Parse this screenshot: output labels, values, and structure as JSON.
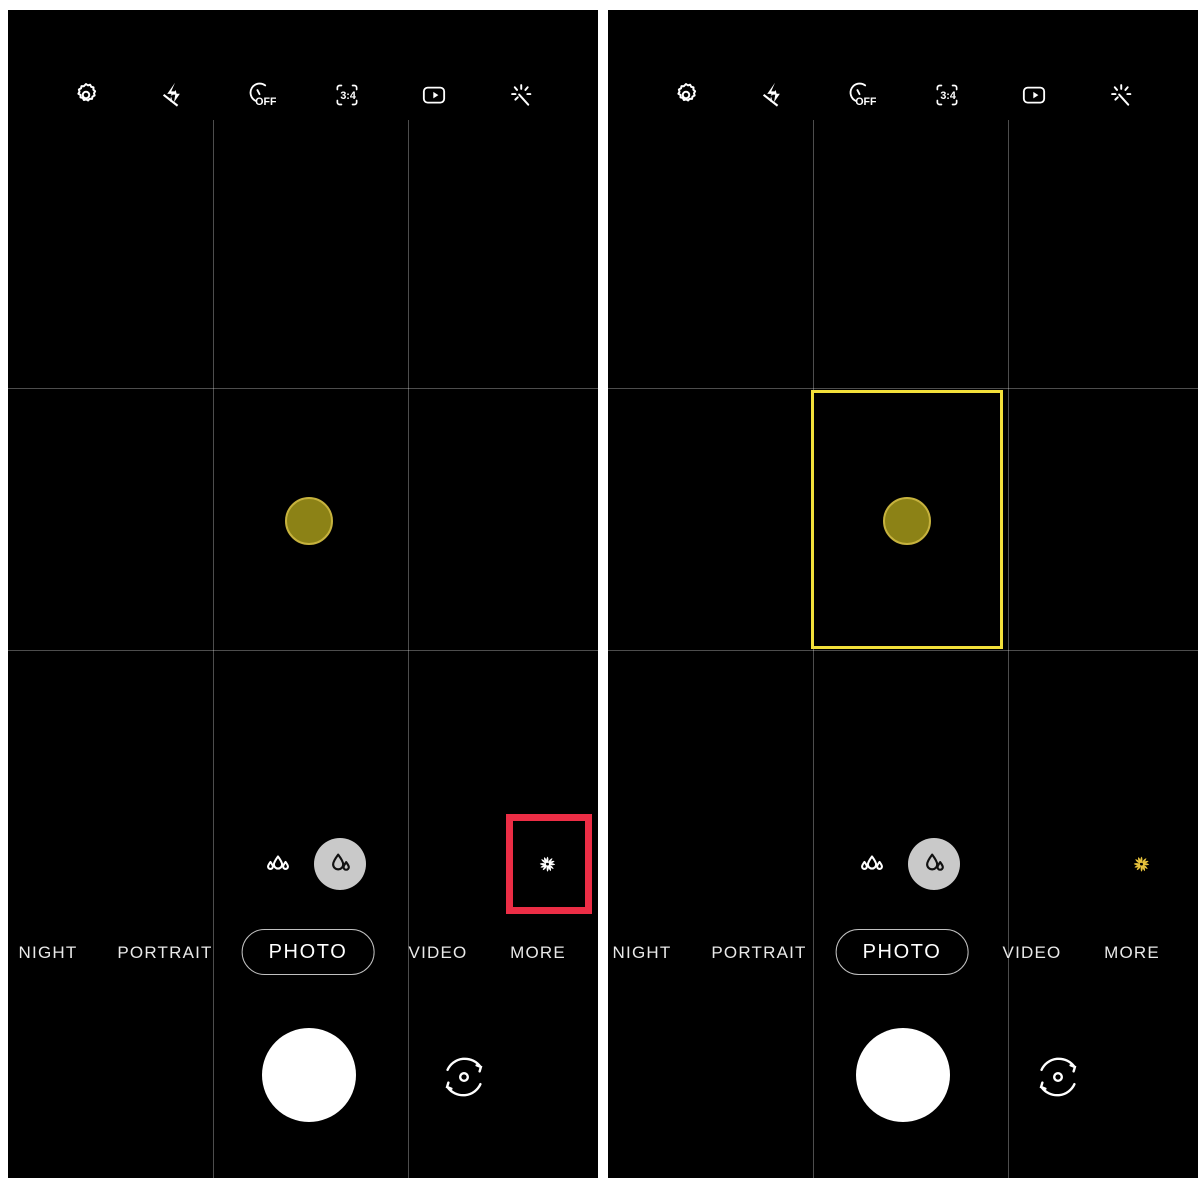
{
  "screenshot": {
    "type": "android-camera-app-comparison",
    "background_color": "#ffffff",
    "panel_background": "#000000"
  },
  "colors": {
    "accent_yellow": "#f3e03a",
    "annotation_red": "#ec2d45",
    "subject_fill": "#8c8216",
    "subject_ring": "#c6b23d",
    "active_filter_gold": "#e8c33c",
    "chip_gray": "#c9c9c9",
    "grid_line": "rgba(255,255,255,0.30)"
  },
  "panels": [
    {
      "id": "before",
      "label": "before-tapping-filter",
      "toolbar": {
        "items": [
          {
            "name": "settings-icon",
            "icon": "gear",
            "label": "Settings"
          },
          {
            "name": "flash-off-icon",
            "icon": "flash-off",
            "label": "Flash off"
          },
          {
            "name": "timer-icon",
            "icon": "timer-off",
            "label": "OFF",
            "value": "OFF"
          },
          {
            "name": "aspect-ratio-icon",
            "icon": "aspect-ratio",
            "label": "3:4",
            "value": "3:4"
          },
          {
            "name": "motion-photo-icon",
            "icon": "motion-photo",
            "label": "Motion photo"
          },
          {
            "name": "ai-enhance-icon",
            "icon": "sparkle",
            "label": "AI enhance"
          }
        ]
      },
      "viewfinder": {
        "grid_visible": true,
        "subject": {
          "name": "subject-circle",
          "shape": "circle",
          "color": "#8c8216"
        },
        "focus_box_visible": false
      },
      "effects": {
        "bokeh_off": {
          "name": "bokeh-off-icon",
          "label": "Bokeh off",
          "selected": false
        },
        "bokeh_on": {
          "name": "bokeh-on-icon",
          "label": "Bokeh on",
          "selected": true
        },
        "filter": {
          "name": "filter-icon",
          "label": "Filters",
          "active": false,
          "color": "#ffffff"
        }
      },
      "annotation": {
        "visible": true,
        "target": "filter-icon",
        "color": "#ec2d45"
      },
      "modes": [
        {
          "name": "mode-night",
          "label": "NIGHT",
          "selected": false
        },
        {
          "name": "mode-portrait",
          "label": "PORTRAIT",
          "selected": false
        },
        {
          "name": "mode-photo",
          "label": "PHOTO",
          "selected": true
        },
        {
          "name": "mode-video",
          "label": "VIDEO",
          "selected": false
        },
        {
          "name": "mode-more",
          "label": "MORE",
          "selected": false
        }
      ],
      "capture": {
        "shutter": {
          "name": "shutter-button",
          "label": "Shutter"
        },
        "flip": {
          "name": "flip-camera-icon",
          "label": "Switch camera"
        }
      }
    },
    {
      "id": "after",
      "label": "after-tapping-filter",
      "toolbar": {
        "items": [
          {
            "name": "settings-icon",
            "icon": "gear",
            "label": "Settings"
          },
          {
            "name": "flash-off-icon",
            "icon": "flash-off",
            "label": "Flash off"
          },
          {
            "name": "timer-icon",
            "icon": "timer-off",
            "label": "OFF",
            "value": "OFF"
          },
          {
            "name": "aspect-ratio-icon",
            "icon": "aspect-ratio",
            "label": "3:4",
            "value": "3:4"
          },
          {
            "name": "motion-photo-icon",
            "icon": "motion-photo",
            "label": "Motion photo"
          },
          {
            "name": "ai-enhance-icon",
            "icon": "sparkle",
            "label": "AI enhance"
          }
        ]
      },
      "viewfinder": {
        "grid_visible": true,
        "subject": {
          "name": "subject-circle",
          "shape": "circle",
          "color": "#8c8216"
        },
        "focus_box_visible": true,
        "focus_box_color": "#f3e03a"
      },
      "effects": {
        "bokeh_off": {
          "name": "bokeh-off-icon",
          "label": "Bokeh off",
          "selected": false
        },
        "bokeh_on": {
          "name": "bokeh-on-icon",
          "label": "Bokeh on",
          "selected": true
        },
        "filter": {
          "name": "filter-icon",
          "label": "Filters",
          "active": true,
          "color": "#e8c33c"
        }
      },
      "annotation": {
        "visible": false,
        "target": null,
        "color": null
      },
      "modes": [
        {
          "name": "mode-night",
          "label": "NIGHT",
          "selected": false
        },
        {
          "name": "mode-portrait",
          "label": "PORTRAIT",
          "selected": false
        },
        {
          "name": "mode-photo",
          "label": "PHOTO",
          "selected": true
        },
        {
          "name": "mode-video",
          "label": "VIDEO",
          "selected": false
        },
        {
          "name": "mode-more",
          "label": "MORE",
          "selected": false
        }
      ],
      "capture": {
        "shutter": {
          "name": "shutter-button",
          "label": "Shutter"
        },
        "flip": {
          "name": "flip-camera-icon",
          "label": "Switch camera"
        }
      }
    }
  ]
}
